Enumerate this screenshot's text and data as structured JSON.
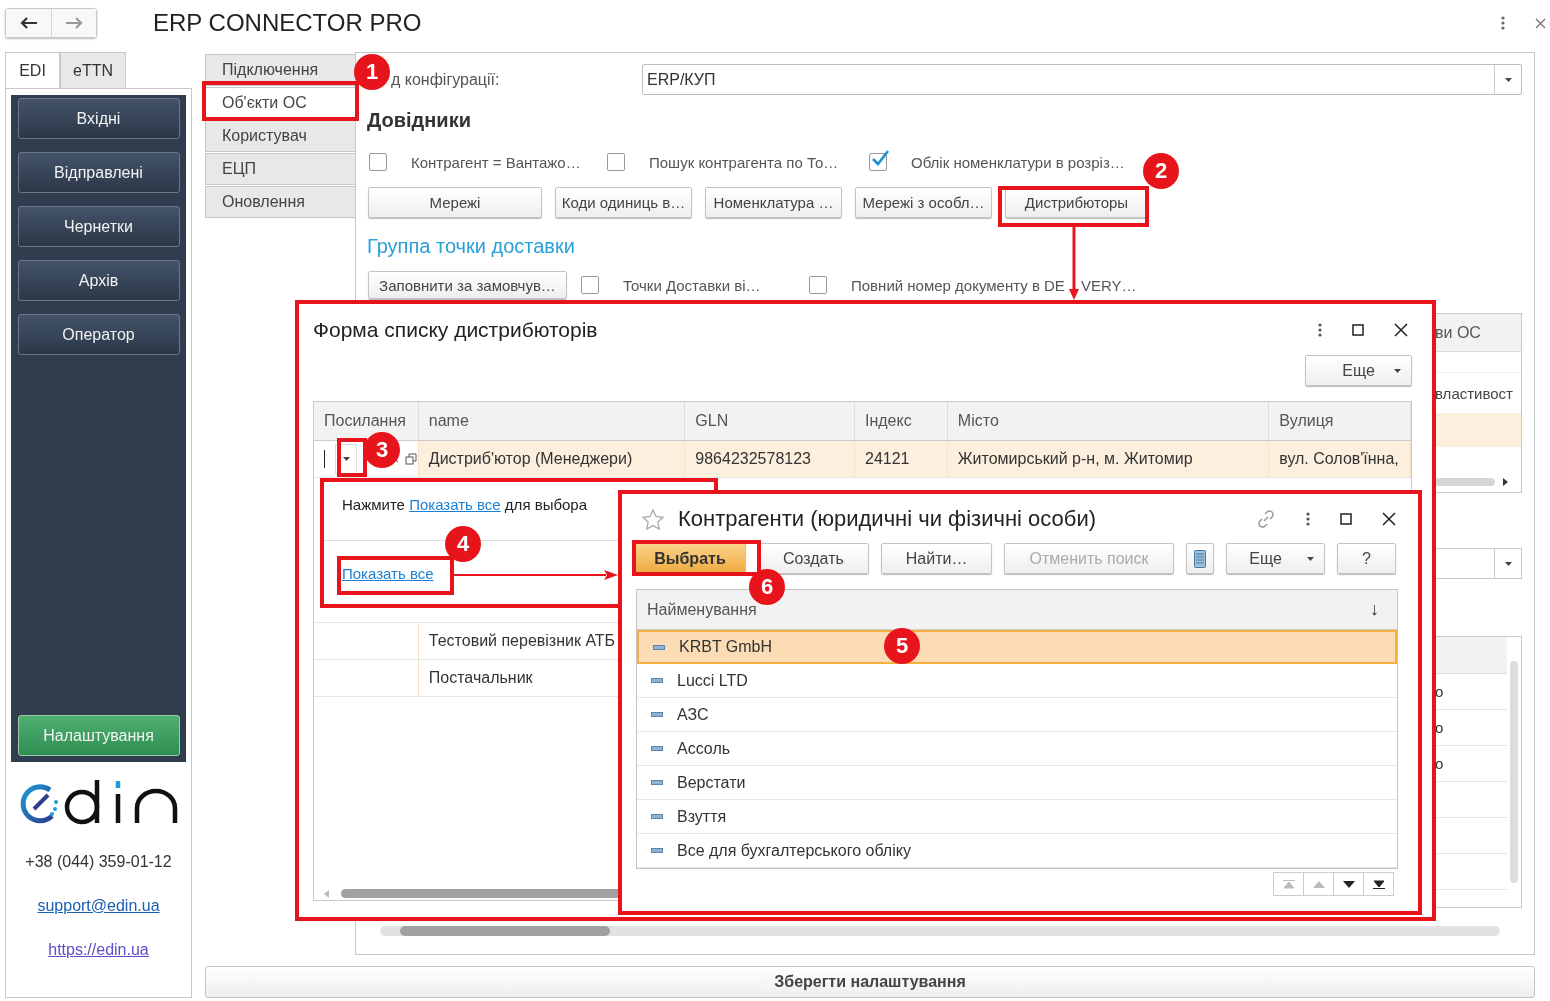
{
  "app": {
    "title": "ERP CONNECTOR PRO"
  },
  "side_tabs": [
    {
      "label": "EDI",
      "selected": true
    },
    {
      "label": "eTTN",
      "selected": false
    }
  ],
  "side_menu": [
    {
      "label": "Вхідні",
      "kind": "dark"
    },
    {
      "label": "Відправлені",
      "kind": "dark"
    },
    {
      "label": "Чернетки",
      "kind": "dark"
    },
    {
      "label": "Архів",
      "kind": "dark"
    },
    {
      "label": "Оператор",
      "kind": "dark"
    },
    {
      "label": "Налаштування",
      "kind": "green"
    }
  ],
  "contacts": {
    "phone": "+38 (044) 359-01-12",
    "email": "support@edin.ua",
    "website": "https://edin.ua"
  },
  "section_tabs": [
    {
      "label": "Підключення",
      "selected": false
    },
    {
      "label": "Об'єкти ОС",
      "selected": true
    },
    {
      "label": "Користувач",
      "selected": false
    },
    {
      "label": "ЕЦП",
      "selected": false
    },
    {
      "label": "Оновлення",
      "selected": false
    }
  ],
  "config": {
    "label": "д конфігурації:",
    "value": "ERP/КУП"
  },
  "directories": {
    "heading": "Довідники",
    "options": [
      {
        "label": "Контрагент = Вантажо…",
        "checked": false
      },
      {
        "label": "Пошук контрагента по То…",
        "checked": false
      },
      {
        "label": "Облік номенклатури в розріз…",
        "checked": true
      }
    ],
    "buttons": [
      "Мережі",
      "Коди одиниць в…",
      "Номенклатура …",
      "Мережі з особл…",
      "Дистрибюторы"
    ]
  },
  "delivery": {
    "heading": "Группа точки доставки",
    "button": "Заповнити за замовчув…",
    "options": [
      {
        "label": "Точки Доставки ві…",
        "checked": false
      },
      {
        "label": "Повний номер документу в DE",
        "label_after": "VERY…",
        "checked": false
      }
    ]
  },
  "background_fragments": {
    "table_header": "ви ОС",
    "table_cell": "властивост",
    "list_cells": [
      "о",
      "о",
      "о"
    ]
  },
  "save_button": "Зберегти налаштування",
  "list_window": {
    "title": "Форма списку дистрибюторів",
    "more_button": "Еще",
    "columns": [
      "Посилання",
      "name",
      "GLN",
      "Індекс",
      "Місто",
      "Вулиця"
    ],
    "rows": [
      {
        "name": "Дистриб'ютор (Менеджери)",
        "gln": "9864232578123",
        "index": "24121",
        "city": "Житомирський р-н, м. Житомир",
        "street": "вул. Солов'їнна,",
        "selected": true,
        "editing": true
      },
      {
        "name": "Тестовий перевізник АТБ",
        "selected": false,
        "editing": false
      },
      {
        "name": "Постачальник",
        "selected": false,
        "editing": false
      }
    ]
  },
  "popup": {
    "hint_before": "Нажмите",
    "hint_link": "Показать все",
    "hint_after": "для выбора",
    "link": "Показать все"
  },
  "dialog": {
    "title": "Контрагенти (юридичні чи фізичні особи)",
    "buttons": [
      {
        "label": "Выбрать",
        "kind": "default"
      },
      {
        "label": "Создать",
        "kind": "normal"
      },
      {
        "label": "Найти…",
        "kind": "normal"
      },
      {
        "label": "Отменить поиск",
        "kind": "disabled"
      },
      {
        "kind": "list"
      },
      {
        "label": "Еще",
        "kind": "menu"
      },
      {
        "label": "?",
        "kind": "normal"
      }
    ],
    "column": "Найменування",
    "sort_mark": "↓",
    "rows": [
      {
        "name": "KRBT GmbH",
        "selected": true
      },
      {
        "name": "Lucci LTD",
        "selected": false
      },
      {
        "name": "АЗС",
        "selected": false
      },
      {
        "name": "Ассоль",
        "selected": false
      },
      {
        "name": "Верстати",
        "selected": false
      },
      {
        "name": "Взуття",
        "selected": false
      },
      {
        "name": "Все для бухгалтерського обліку",
        "selected": false
      }
    ]
  },
  "annotations": [
    "1",
    "2",
    "3",
    "4",
    "5",
    "6"
  ]
}
